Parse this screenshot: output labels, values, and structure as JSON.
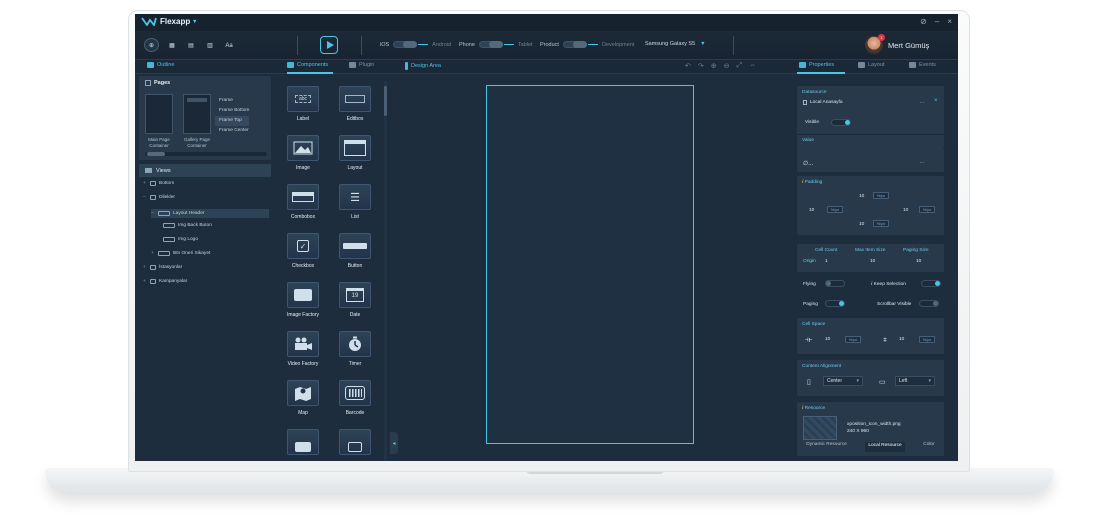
{
  "app": {
    "name": "Flexapp"
  },
  "window_controls": {
    "pin": "⊘",
    "minimize": "–",
    "close": "×"
  },
  "toolbar": {
    "buttons": [
      {
        "icon": "globe-icon",
        "glyph": "⊕"
      },
      {
        "icon": "grid-icon",
        "glyph": "▦"
      },
      {
        "icon": "layout-icon",
        "glyph": "▤"
      },
      {
        "icon": "list-icon",
        "glyph": "▥"
      },
      {
        "icon": "font-icon",
        "glyph": "Aa"
      }
    ],
    "ios": "iOS",
    "android": "Android",
    "phone": "Phone",
    "tablet": "Tablet",
    "product": "Product",
    "development": "Development",
    "device": "Samsung Galaxy S5",
    "device_arrow": "▼"
  },
  "user": {
    "name": "Mert Gümüş",
    "badge": "1"
  },
  "tabs": {
    "outline": "Outline",
    "components": "Components",
    "plugin": "Plugin",
    "design_area": "Design Area",
    "properties": "Properties",
    "layout": "Layout",
    "events": "Events"
  },
  "pages": {
    "title": "Pages",
    "thumbs": [
      {
        "label": "Main Page Container"
      },
      {
        "label": "Gallery Page Container"
      }
    ],
    "frames": [
      "Frame",
      "Frame Bottom",
      "Frame Top",
      "Frame Center"
    ]
  },
  "views": {
    "title": "Views",
    "items": [
      "Bottom",
      "Dilekler",
      "Layout Header",
      "Img Back Buton",
      "Img Logo",
      "Btn Oneri Sikayet",
      "İstasyonlar",
      "Kampanyalar"
    ]
  },
  "components": [
    {
      "label": "Label",
      "icon": "label-icon",
      "glyph": "abc"
    },
    {
      "label": "Editbox",
      "icon": "editbox-icon",
      "glyph": "▭"
    },
    {
      "label": "Image",
      "icon": "image-icon",
      "glyph": "▲"
    },
    {
      "label": "Layout",
      "icon": "layout-icon",
      "glyph": "▤"
    },
    {
      "label": "Combobox",
      "icon": "combobox-icon",
      "glyph": "▬"
    },
    {
      "label": "List",
      "icon": "list-icon",
      "glyph": "☰"
    },
    {
      "label": "Checkbox",
      "icon": "checkbox-icon",
      "glyph": "✓"
    },
    {
      "label": "Button",
      "icon": "button-icon",
      "glyph": "▬"
    },
    {
      "label": "Image Factory",
      "icon": "image-factory-icon",
      "glyph": "▣"
    },
    {
      "label": "Date",
      "icon": "date-icon",
      "glyph": "19"
    },
    {
      "label": "Video Factory",
      "icon": "video-factory-icon",
      "glyph": "■"
    },
    {
      "label": "Timer",
      "icon": "timer-icon",
      "glyph": "◔"
    },
    {
      "label": "Map",
      "icon": "map-icon",
      "glyph": "◆"
    },
    {
      "label": "Barcode",
      "icon": "barcode-icon",
      "glyph": "|||"
    }
  ],
  "properties": {
    "datasource": {
      "title": "Datasource",
      "value": "Local Anasayfa",
      "more": "...",
      "clear": "×"
    },
    "visible": {
      "label": "Visible"
    },
    "value": {
      "title": "Value",
      "value": "∅...",
      "more": "..."
    },
    "padding": {
      "title": "Padding",
      "top": "10",
      "left": "10",
      "right": "10",
      "bottom": "10",
      "unit": "%/px"
    },
    "cells": {
      "cell_count": "Cell Count",
      "max_item_size": "Max Item Size",
      "paging_size": "Paging Size",
      "origin": "Origin",
      "origin_value": "1",
      "max_value": "10",
      "paging_value": "10"
    },
    "flying": {
      "label": "Flying"
    },
    "keep_selection": {
      "label": "Keep Selection"
    },
    "paging": {
      "label": "Paging"
    },
    "scrollbar_visible": {
      "label": "Scrollbar Visible"
    },
    "cell_space": {
      "title": "Cell Space",
      "h_value": "10",
      "v_value": "10",
      "unit": "%/px"
    },
    "content_alignment": {
      "title": "Content Alignment",
      "vertical": "Center",
      "horizontal": "Left",
      "arrow": "▾"
    },
    "resource": {
      "title": "Resource",
      "file": "xposition_icon_width.png",
      "size": "240 X 960",
      "tabs": [
        "Dynamic Resource",
        "Local Resource",
        "Color"
      ]
    }
  },
  "colors": {
    "accent": "#49c6e5",
    "bg": "#1e2d3e",
    "panel": "#27394b"
  }
}
